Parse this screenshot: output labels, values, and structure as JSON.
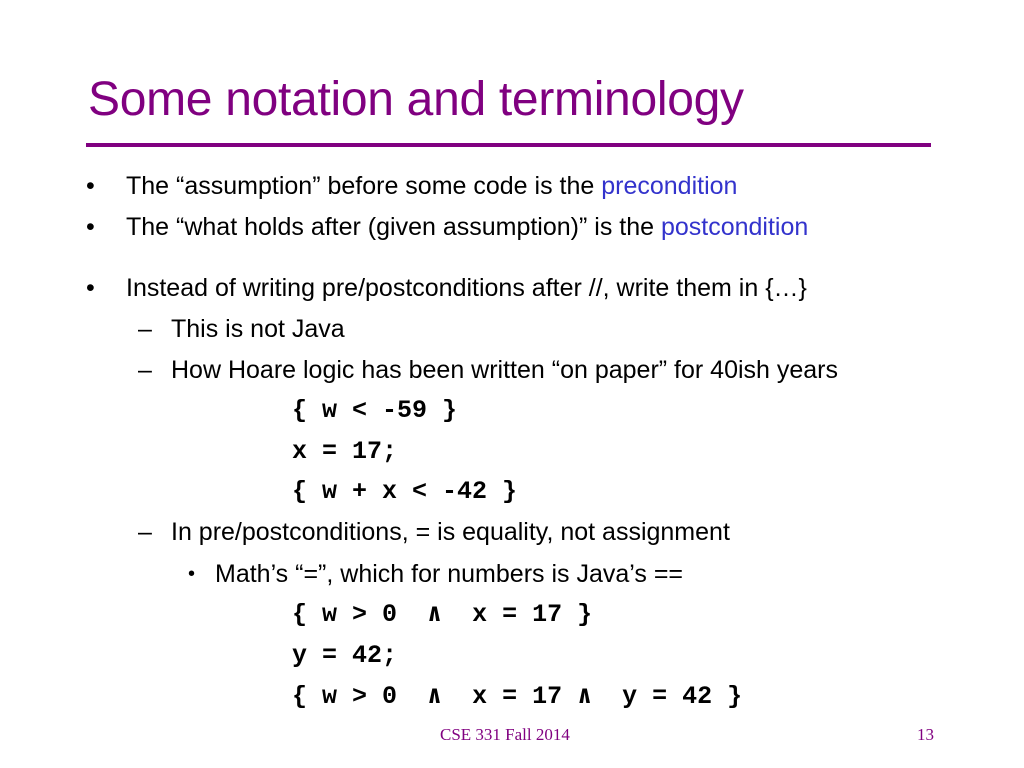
{
  "slide": {
    "title": "Some notation and terminology",
    "bullets": [
      {
        "marker": "•",
        "text": "The “assumption” before some code is the ",
        "term": "precondition"
      },
      {
        "marker": "•",
        "text": "The “what holds after (given assumption)” is the ",
        "term": "postcondition"
      },
      {
        "marker": "•",
        "text": "Instead of writing pre/postconditions after //, write them in {…}"
      }
    ],
    "sub_items": [
      {
        "marker": "–",
        "text": "This is not Java"
      },
      {
        "marker": "–",
        "text": "How Hoare logic has been written “on paper” for 40ish years"
      },
      {
        "marker": "–",
        "text": "In pre/postconditions, = is equality, not assignment"
      }
    ],
    "sub_sub_items": [
      {
        "marker": "•",
        "text": "Math’s “=”, which for numbers is Java’s =="
      }
    ],
    "code_block_1": [
      "{ w < -59 }",
      "x = 17;",
      "{ w + x < -42 }"
    ],
    "code_block_2": [
      "{ w > 0  ∧  x = 17 }",
      "y = 42;",
      "{ w > 0  ∧  x = 17 ∧  y = 42 }"
    ]
  },
  "footer": {
    "course": "CSE 331 Fall 2014",
    "page_number": "13"
  },
  "colors": {
    "title": "#800080",
    "term": "#3333cc",
    "footer": "#800080"
  }
}
